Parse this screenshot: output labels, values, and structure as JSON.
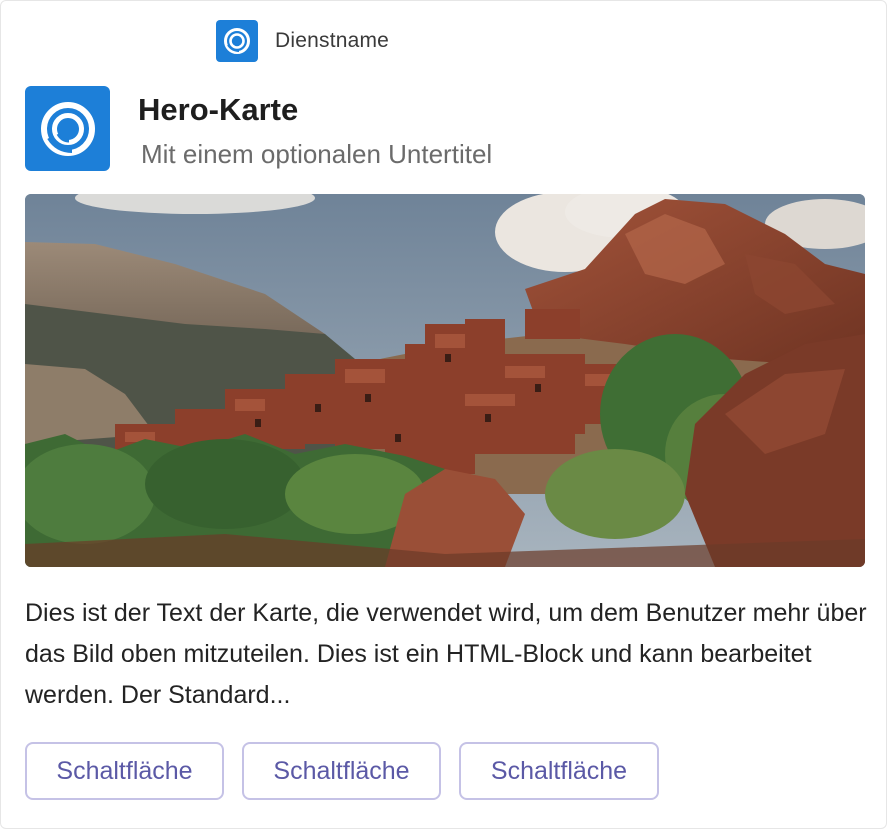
{
  "service": {
    "logo_icon": "ring-logo-icon",
    "name": "Dienstname"
  },
  "hero": {
    "logo_icon": "ring-logo-icon",
    "title": "Hero-Karte",
    "subtitle": "Mit einem optionalen Untertitel",
    "image": "mountain-village-photo"
  },
  "body": {
    "text": "Dies ist der Text der Karte, die verwendet wird, um dem Benutzer mehr über das Bild oben mitzuteilen. Dies ist ein HTML-Block und kann bearbeitet werden. Der Standard..."
  },
  "actions": [
    {
      "label": "Schaltfläche"
    },
    {
      "label": "Schaltfläche"
    },
    {
      "label": "Schaltfläche"
    }
  ],
  "colors": {
    "brand": "#1d7fd8",
    "button_text": "#5b59a6",
    "button_border": "#c5c2e6"
  }
}
